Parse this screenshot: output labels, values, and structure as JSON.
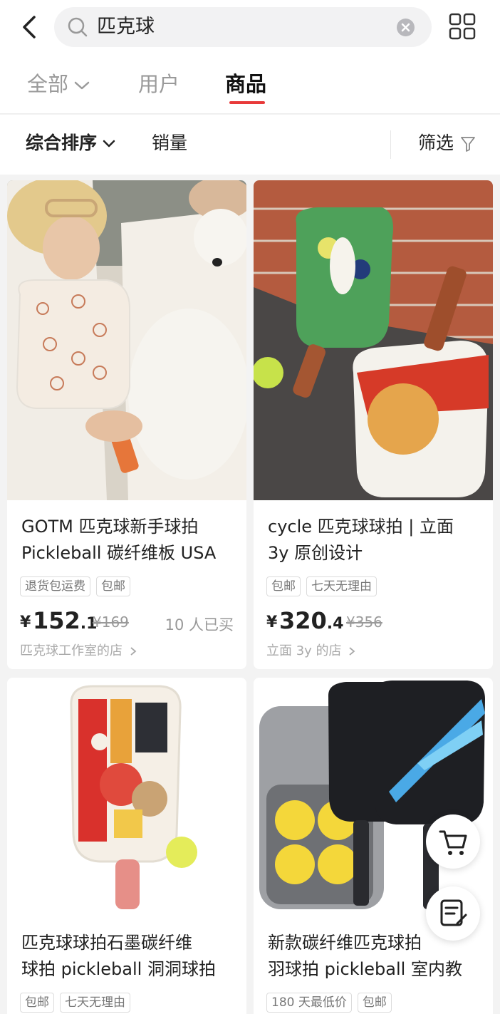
{
  "search": {
    "query": "匹克球"
  },
  "tabs": [
    {
      "label": "全部"
    },
    {
      "label": "用户"
    },
    {
      "label": "商品"
    }
  ],
  "sort": {
    "composite": "综合排序",
    "sales": "销量",
    "filter": "筛选"
  },
  "products": [
    {
      "title_line1": "GOTM 匹克球新手球拍",
      "title_line2": "Pickleball 碳纤维板 USA",
      "tags": [
        "退货包运费",
        "包邮"
      ],
      "price_yen": "¥",
      "price_int": "152",
      "price_dec": ".1",
      "price_orig": "¥169",
      "sold": "10 人已买",
      "shop": "匹克球工作室的店"
    },
    {
      "title_line1": "cycle 匹克球球拍 | 立面",
      "title_line2": "3y 原创设计",
      "tags": [
        "包邮",
        "七天无理由"
      ],
      "price_yen": "¥",
      "price_int": "320",
      "price_dec": ".4",
      "price_orig": "¥356",
      "sold": "",
      "shop": "立面 3y 的店"
    },
    {
      "title_line1": "匹克球球拍石墨碳纤维",
      "title_line2": "球拍 pickleball 洞洞球拍",
      "tags": [
        "包邮",
        "七天无理由"
      ]
    },
    {
      "title_line1": "新款碳纤维匹克球拍",
      "title_line2": "羽球拍 pickleball 室内教",
      "tags": [
        "180 天最低价",
        "包邮"
      ]
    }
  ],
  "colors": {
    "accent": "#e83a3a",
    "background": "#f3f3f3"
  },
  "icons": [
    "back-arrow-icon",
    "search-icon",
    "clear-icon",
    "grid-icon",
    "chevron-down-icon",
    "filter-icon",
    "chevron-right-icon",
    "cart-icon",
    "notes-icon"
  ]
}
